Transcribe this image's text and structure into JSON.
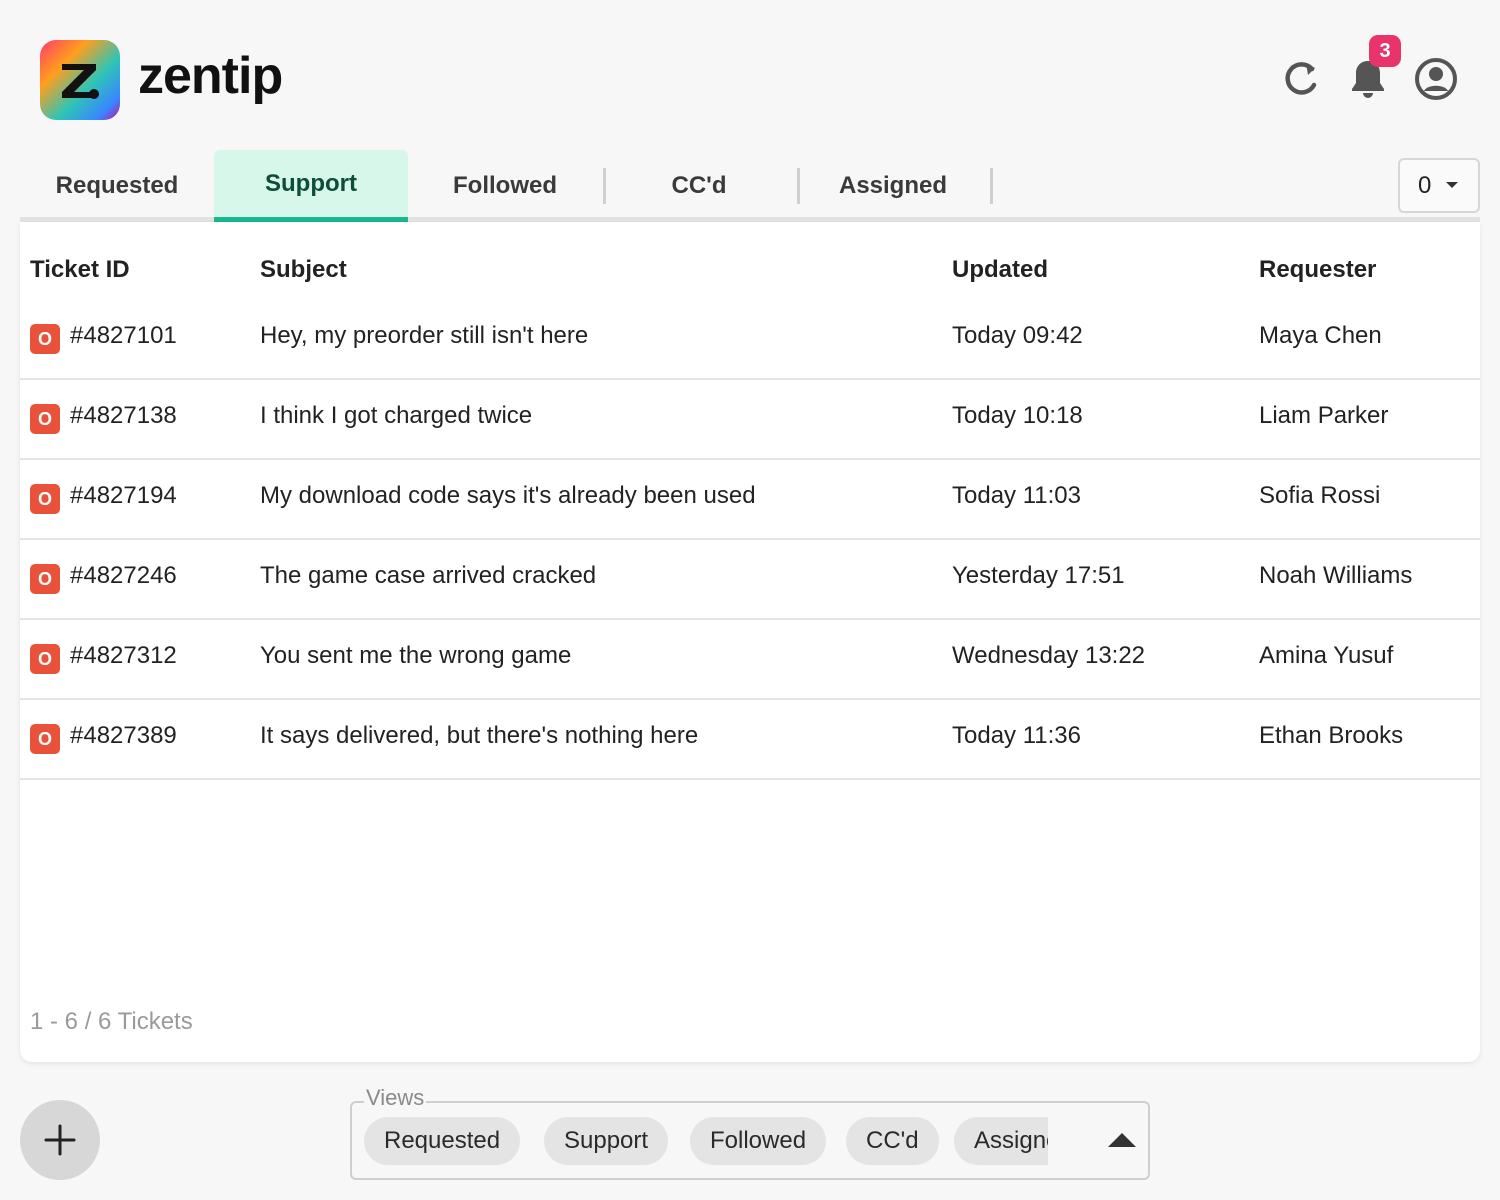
{
  "app": {
    "name": "zentip",
    "notification_count": "3"
  },
  "tabs": [
    {
      "label": "Requested"
    },
    {
      "label": "Support",
      "active": true
    },
    {
      "label": "Followed"
    },
    {
      "label": "CC'd"
    },
    {
      "label": "Assigned"
    }
  ],
  "count_select": {
    "value": "0"
  },
  "table": {
    "headers": {
      "id": "Ticket ID",
      "subject": "Subject",
      "updated": "Updated",
      "requester": "Requester"
    },
    "rows": [
      {
        "status": "O",
        "id": "#4827101",
        "subject": "Hey, my preorder still isn't here",
        "updated": "Today 09:42",
        "requester": "Maya Chen"
      },
      {
        "status": "O",
        "id": "#4827138",
        "subject": "I think I got charged twice",
        "updated": "Today 10:18",
        "requester": "Liam Parker"
      },
      {
        "status": "O",
        "id": "#4827194",
        "subject": "My download code says it's already been used",
        "updated": "Today 11:03",
        "requester": "Sofia Rossi"
      },
      {
        "status": "O",
        "id": "#4827246",
        "subject": "The game case arrived cracked",
        "updated": "Yesterday 17:51",
        "requester": "Noah Williams"
      },
      {
        "status": "O",
        "id": "#4827312",
        "subject": "You sent me the wrong game",
        "updated": "Wednesday 13:22",
        "requester": "Amina Yusuf"
      },
      {
        "status": "O",
        "id": "#4827389",
        "subject": "It says delivered, but there's nothing here",
        "updated": "Today 11:36",
        "requester": "Ethan Brooks"
      }
    ],
    "footer": "1 - 6 / 6 Tickets"
  },
  "views": {
    "legend": "Views",
    "chips": [
      "Requested",
      "Support",
      "Followed",
      "CC'd",
      "Assigned"
    ]
  },
  "colors": {
    "accent": "#17b890",
    "active_tab_bg": "#d6f7ea",
    "status_open": "#e8523a",
    "badge": "#e8336b"
  },
  "icons": [
    "refresh-icon",
    "bell-icon",
    "profile-icon",
    "plus-icon",
    "caret-up-icon"
  ]
}
